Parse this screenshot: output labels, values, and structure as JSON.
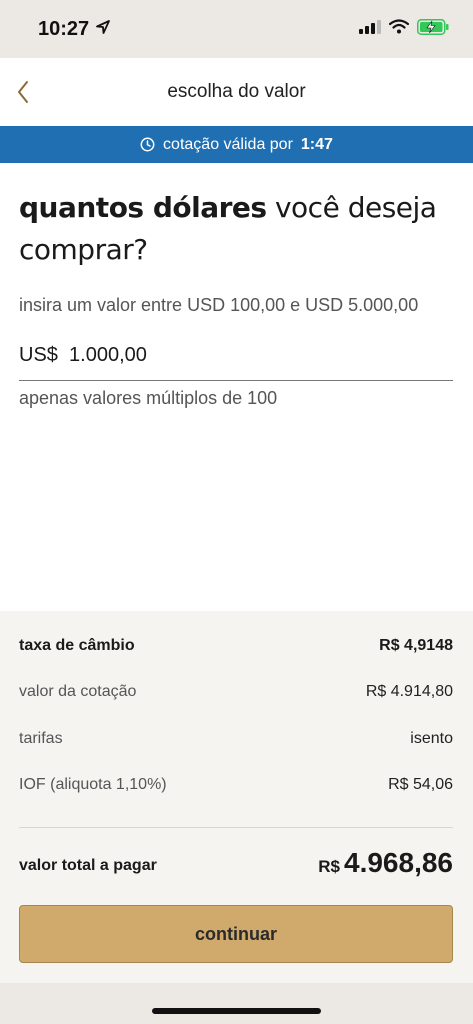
{
  "status_bar": {
    "time": "10:27"
  },
  "header": {
    "title": "escolha do valor"
  },
  "quote_banner": {
    "prefix": "cotação válida por",
    "countdown": "1:47"
  },
  "main": {
    "question_bold": "quantos dólares",
    "question_rest": "você deseja comprar?",
    "range_hint": "insira um valor entre USD 100,00 e USD 5.000,00",
    "amount_value": "US$  1.000,00",
    "multiples_hint": "apenas valores múltiplos de 100"
  },
  "summary": {
    "exchange_rate_label": "taxa de câmbio",
    "exchange_rate_value": "R$ 4,9148",
    "quote_value_label": "valor da cotação",
    "quote_value_value": "R$ 4.914,80",
    "fees_label": "tarifas",
    "fees_value": "isento",
    "iof_label": "IOF (aliquota 1,10%)",
    "iof_value": "R$ 54,06",
    "total_label": "valor total a pagar",
    "total_currency": "R$",
    "total_amount": "4.968,86",
    "continue_label": "continuar"
  },
  "colors": {
    "banner": "#1f6fb2",
    "button": "#cfaa6c",
    "battery": "#34c759"
  },
  "icons": {
    "back": "chevron-left-icon",
    "clock": "clock-icon",
    "location": "location-arrow-icon",
    "signal": "cellular-signal-icon",
    "wifi": "wifi-icon",
    "battery": "battery-charging-icon"
  }
}
